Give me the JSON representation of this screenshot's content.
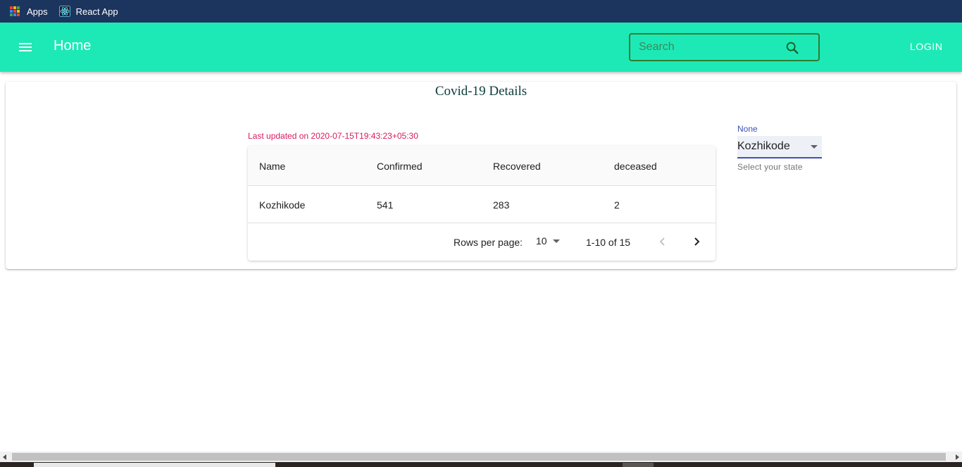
{
  "bookmarks": {
    "apps_label": "Apps",
    "react_app_label": "React App"
  },
  "appbar": {
    "title": "Home",
    "search_placeholder": "Search",
    "login_label": "LOGIN"
  },
  "main": {
    "title": "Covid-19 Details",
    "last_updated": "Last updated on 2020-07-15T19:43:23+05:30"
  },
  "table": {
    "headers": [
      "Name",
      "Confirmed",
      "Recovered",
      "deceased"
    ],
    "rows": [
      [
        "Kozhikode",
        "541",
        "283",
        "2"
      ]
    ],
    "pagination": {
      "rows_per_page_label": "Rows per page:",
      "rows_per_page_value": "10",
      "range": "1-10 of 15"
    }
  },
  "state_select": {
    "label": "None",
    "value": "Kozhikode",
    "helper": "Select your state"
  },
  "colors": {
    "appbar": "#1de9b6",
    "bookmarks_bar": "#1c355e",
    "last_updated_text": "#d81b60",
    "select_accent": "#3f51b5"
  }
}
